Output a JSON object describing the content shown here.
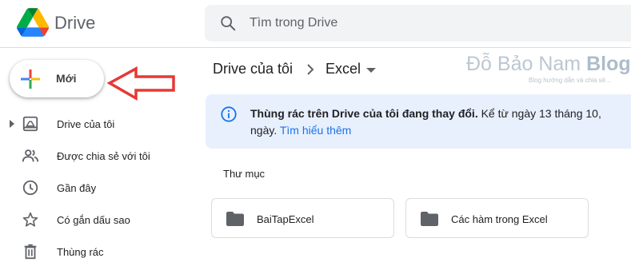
{
  "app": {
    "name": "Drive"
  },
  "search": {
    "placeholder": "Tìm trong Drive"
  },
  "new_button": {
    "label": "Mới"
  },
  "sidebar": {
    "items": [
      {
        "label": "Drive của tôi",
        "icon": "my-drive-icon"
      },
      {
        "label": "Được chia sẻ với tôi",
        "icon": "shared-icon"
      },
      {
        "label": "Gần đây",
        "icon": "recent-clock-icon"
      },
      {
        "label": "Có gắn dấu sao",
        "icon": "star-icon"
      },
      {
        "label": "Thùng rác",
        "icon": "trash-icon"
      }
    ]
  },
  "breadcrumb": {
    "root": "Drive của tôi",
    "current": "Excel"
  },
  "watermark": {
    "title_main": "Đỗ Bảo Nam ",
    "title_brand": "Blog",
    "subtitle": "Blog hướng dẫn và chia sẻ..."
  },
  "banner": {
    "heading": "Thùng rác trên Drive của tôi đang thay đổi.",
    "text": " Kể từ ngày 13 tháng 10,",
    "text_line2": "ngày. ",
    "link": "Tìm hiểu thêm"
  },
  "folders_section": {
    "title": "Thư mục"
  },
  "folders": [
    {
      "name": "BaiTapExcel"
    },
    {
      "name": "Các hàm trong Excel"
    }
  ],
  "colors": {
    "accent_blue": "#1a73e8",
    "banner_bg": "#e8f0fe",
    "annotation_arrow": "#e53935"
  }
}
